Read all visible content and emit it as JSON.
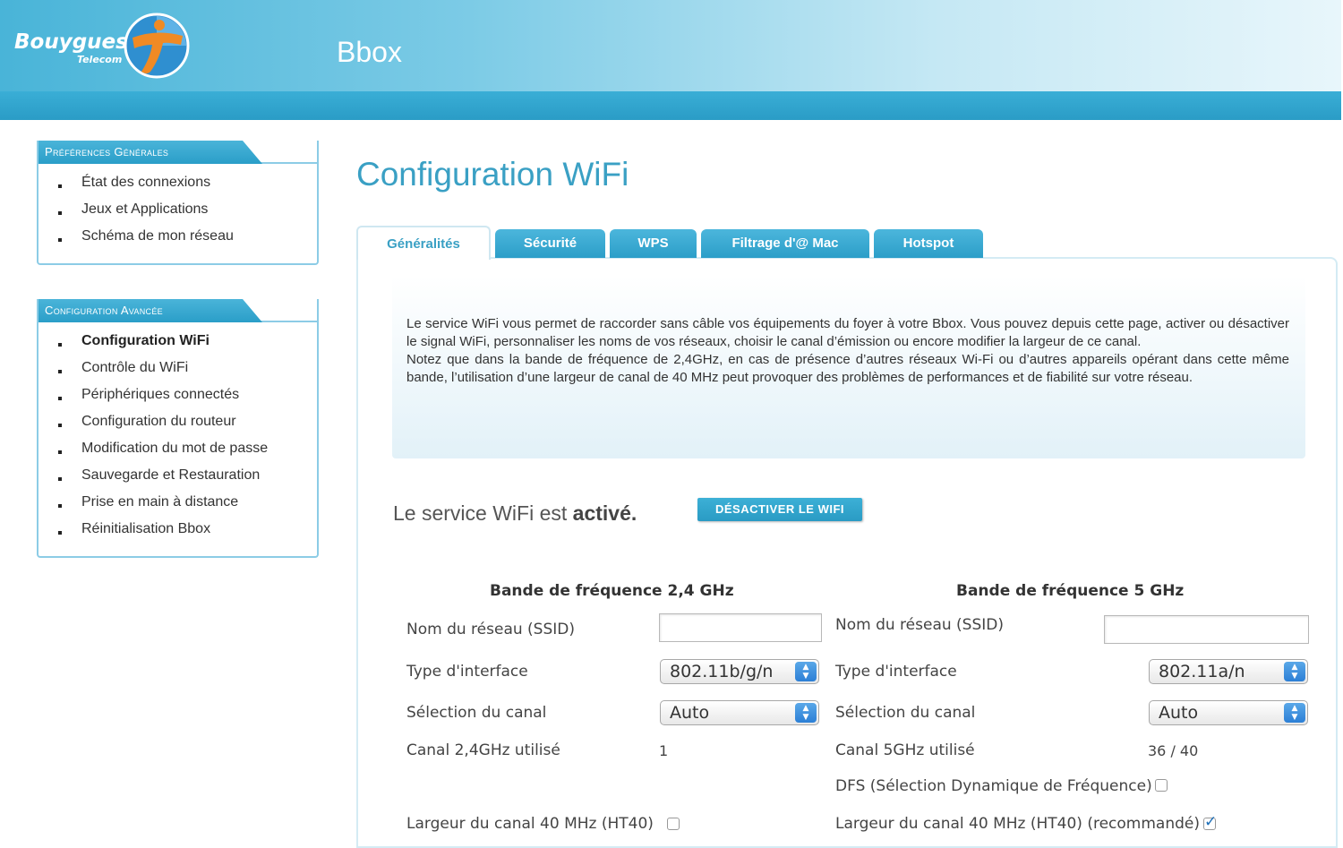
{
  "header": {
    "brand": "Bouygues",
    "brand_sub": "Telecom",
    "app_title": "Bbox"
  },
  "sidebar": {
    "sections": [
      {
        "title": "Préférences Générales",
        "items": [
          {
            "label": "État des connexions"
          },
          {
            "label": "Jeux et Applications"
          },
          {
            "label": "Schéma de mon réseau"
          }
        ]
      },
      {
        "title": "Configuration Avancée",
        "items": [
          {
            "label": "Configuration WiFi",
            "active": true
          },
          {
            "label": "Contrôle du WiFi"
          },
          {
            "label": "Périphériques connectés"
          },
          {
            "label": "Configuration du routeur"
          },
          {
            "label": "Modification du mot de passe"
          },
          {
            "label": "Sauvegarde et Restauration"
          },
          {
            "label": "Prise en main à distance"
          },
          {
            "label": "Réinitialisation Bbox"
          }
        ]
      }
    ]
  },
  "main": {
    "title": "Configuration WiFi",
    "tabs": [
      {
        "label": "Généralités",
        "active": true
      },
      {
        "label": "Sécurité"
      },
      {
        "label": "WPS"
      },
      {
        "label": "Filtrage d'@ Mac"
      },
      {
        "label": "Hotspot"
      }
    ],
    "info": {
      "paragraph1": "Le service WiFi vous permet de raccorder sans câble vos équipements du foyer à votre Bbox. Vous pouvez depuis cette page, activer ou désactiver le signal WiFi, personnaliser les noms de vos réseaux, choisir le canal d’émission ou encore modifier la largeur de ce canal.",
      "paragraph2": "Notez que dans la bande de fréquence de 2,4GHz, en cas de présence d’autres réseaux Wi-Fi ou d’autres appareils opérant dans cette même bande, l’utilisation d’une largeur de canal de 40 MHz peut provoquer des problèmes de performances et de fiabilité sur votre réseau."
    },
    "status": {
      "prefix": "Le service WiFi est",
      "state": "activé.",
      "button_label": "DÉSACTIVER LE WIFI"
    },
    "band24": {
      "heading": "Bande de fréquence 2,4 GHz",
      "ssid_label": "Nom du réseau (SSID)",
      "ssid_value": "",
      "interface_label": "Type d'interface",
      "interface_value": "802.11b/g/n",
      "channel_label": "Sélection du canal",
      "channel_value": "Auto",
      "used_label": "Canal 2,4GHz utilisé",
      "used_value": "1",
      "ht40_label": "Largeur du canal 40 MHz (HT40)",
      "ht40_checked": false
    },
    "band5": {
      "heading": "Bande de fréquence 5 GHz",
      "ssid_label": "Nom du réseau (SSID)",
      "ssid_value": "",
      "interface_label": "Type d'interface",
      "interface_value": "802.11a/n",
      "channel_label": "Sélection du canal",
      "channel_value": "Auto",
      "used_label": "Canal 5GHz utilisé",
      "used_value": "36 / 40",
      "dfs_label": "DFS (Sélection Dynamique de Fréquence)",
      "dfs_checked": false,
      "ht40_label": "Largeur du canal 40 MHz (HT40) (recommandé)",
      "ht40_checked": true
    }
  },
  "colors": {
    "accent": "#3aa0c4",
    "tab_blue": "#2b9ec8",
    "sidebar_border": "#8ccce6"
  }
}
